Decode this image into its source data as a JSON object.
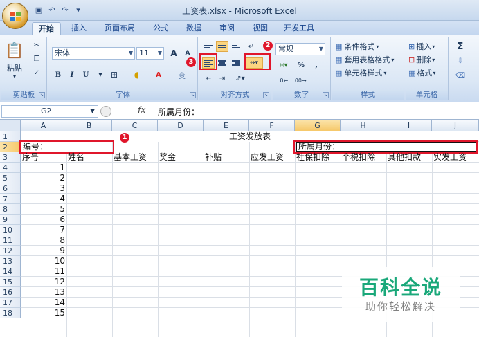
{
  "window": {
    "title": "工资表.xlsx - Microsoft Excel"
  },
  "tabs": [
    "开始",
    "插入",
    "页面布局",
    "公式",
    "数据",
    "审阅",
    "视图",
    "开发工具"
  ],
  "ribbon": {
    "clipboard": {
      "paste_label": "粘贴",
      "group_label": "剪贴板"
    },
    "font": {
      "font_name": "宋体",
      "font_size": "11",
      "grow": "A",
      "shrink": "A",
      "bold": "B",
      "italic": "I",
      "underline": "U",
      "phonetic": "变",
      "group_label": "字体"
    },
    "alignment": {
      "group_label": "对齐方式"
    },
    "number": {
      "format": "常规",
      "percent": "%",
      "comma": ",",
      "group_label": "数字"
    },
    "styles": {
      "conditional": "条件格式",
      "table": "套用表格格式",
      "cell": "单元格样式",
      "group_label": "样式"
    },
    "cells": {
      "insert": "插入",
      "delete": "删除",
      "format": "格式",
      "group_label": "单元格"
    },
    "editing": {
      "sum": "Σ"
    }
  },
  "annotations": {
    "one": "1",
    "two": "2",
    "three": "3"
  },
  "formula_bar": {
    "name_box": "G2",
    "fx": "fx",
    "content": "所属月份："
  },
  "columns": [
    "A",
    "B",
    "C",
    "D",
    "E",
    "F",
    "G",
    "H",
    "I",
    "J"
  ],
  "rows": [
    "1",
    "2",
    "3",
    "4",
    "5",
    "6",
    "7",
    "8",
    "9",
    "10",
    "11",
    "12",
    "13",
    "14",
    "15",
    "16",
    "17",
    "18"
  ],
  "sheet": {
    "title": "工资发放表",
    "id_label": "编号：",
    "month_label": "所属月份：",
    "headers": [
      "序号",
      "姓名",
      "基本工资",
      "奖金",
      "补贴",
      "应发工资",
      "社保扣除",
      "个税扣除",
      "其他扣款",
      "实发工资"
    ],
    "serials": [
      "1",
      "2",
      "3",
      "4",
      "5",
      "6",
      "7",
      "8",
      "9",
      "10",
      "11",
      "12",
      "13",
      "14",
      "15"
    ]
  },
  "watermark": {
    "title": "百科全说",
    "subtitle": "助你轻松解决"
  }
}
